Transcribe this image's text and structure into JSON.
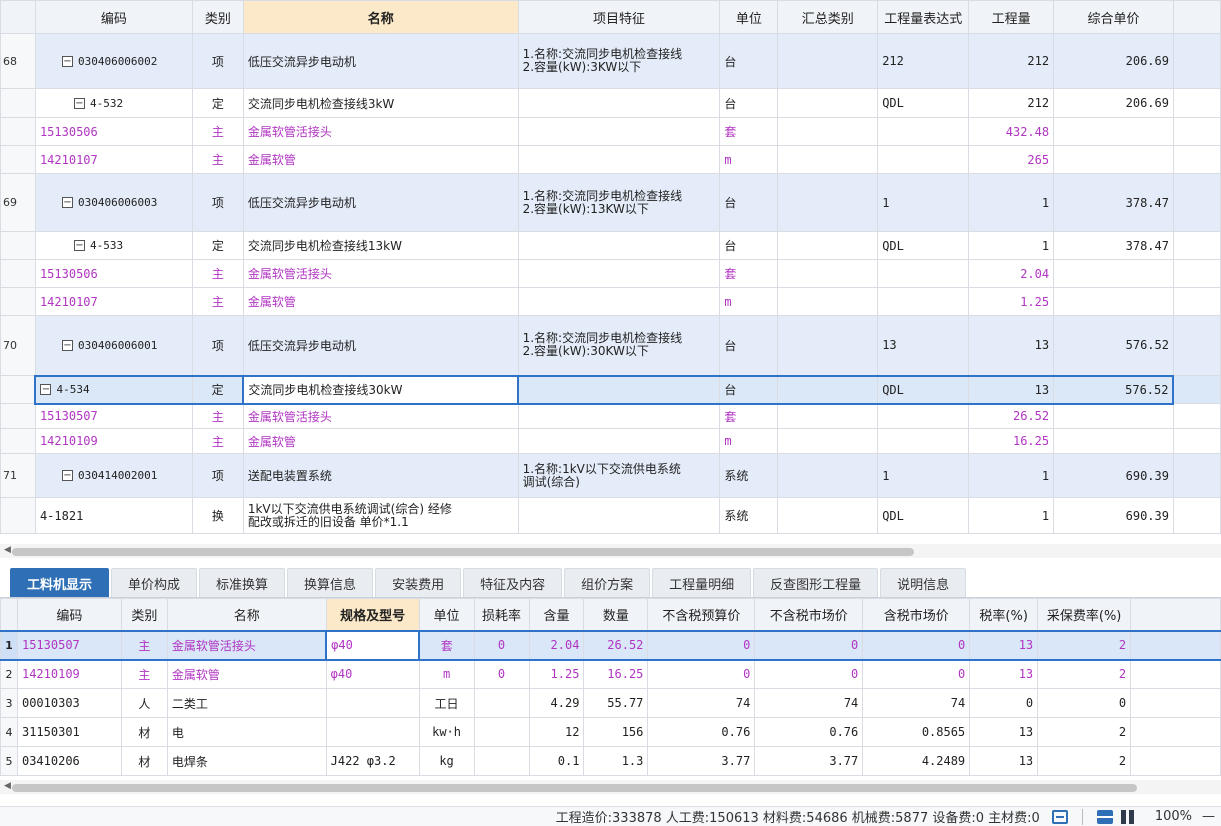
{
  "upper": {
    "headers": [
      "编码",
      "类别",
      "名称",
      "项目特征",
      "单位",
      "汇总类别",
      "工程量表达式",
      "工程量",
      "综合单价"
    ],
    "rows": [
      {
        "type": "item",
        "rn": "68",
        "code": "030406006002",
        "cat": "项",
        "name": "低压交流异步电动机",
        "feat1": "1.名称:交流同步电机检查接线",
        "feat2": "2.容量(kW):3KW以下",
        "unit": "台",
        "summary": "",
        "expr": "212",
        "qty": "212",
        "price": "206.69"
      },
      {
        "type": "quota",
        "rn": "",
        "code": "4-532",
        "cat": "定",
        "name": "交流同步电机检查接线3kW",
        "feat1": "",
        "feat2": "",
        "unit": "台",
        "summary": "",
        "expr": "QDL",
        "qty": "212",
        "price": "206.69"
      },
      {
        "type": "main",
        "rn": "",
        "code": "15130506",
        "cat": "主",
        "name": "金属软管活接头",
        "feat1": "",
        "feat2": "",
        "unit": "套",
        "summary": "",
        "expr": "",
        "qty": "432.48",
        "price": ""
      },
      {
        "type": "main",
        "rn": "",
        "code": "14210107",
        "cat": "主",
        "name": "金属软管",
        "feat1": "",
        "feat2": "",
        "unit": "m",
        "summary": "",
        "expr": "",
        "qty": "265",
        "price": ""
      },
      {
        "type": "item",
        "rn": "69",
        "code": "030406006003",
        "cat": "项",
        "name": "低压交流异步电动机",
        "feat1": "1.名称:交流同步电机检查接线",
        "feat2": "2.容量(kW):13KW以下",
        "unit": "台",
        "summary": "",
        "expr": "1",
        "qty": "1",
        "price": "378.47"
      },
      {
        "type": "quota",
        "rn": "",
        "code": "4-533",
        "cat": "定",
        "name": "交流同步电机检查接线13kW",
        "feat1": "",
        "feat2": "",
        "unit": "台",
        "summary": "",
        "expr": "QDL",
        "qty": "1",
        "price": "378.47"
      },
      {
        "type": "main",
        "rn": "",
        "code": "15130506",
        "cat": "主",
        "name": "金属软管活接头",
        "feat1": "",
        "feat2": "",
        "unit": "套",
        "summary": "",
        "expr": "",
        "qty": "2.04",
        "price": ""
      },
      {
        "type": "main",
        "rn": "",
        "code": "14210107",
        "cat": "主",
        "name": "金属软管",
        "feat1": "",
        "feat2": "",
        "unit": "m",
        "summary": "",
        "expr": "",
        "qty": "1.25",
        "price": ""
      },
      {
        "type": "item",
        "rn": "70",
        "code": "030406006001",
        "cat": "项",
        "name": "低压交流异步电动机",
        "feat1": "1.名称:交流同步电机检查接线",
        "feat2": "2.容量(kW):30KW以下",
        "unit": "台",
        "summary": "",
        "expr": "13",
        "qty": "13",
        "price": "576.52"
      },
      {
        "type": "quota-sel",
        "rn": "",
        "code": "4-534",
        "cat": "定",
        "name": "交流同步电机检查接线30kW",
        "feat1": "",
        "feat2": "",
        "unit": "台",
        "summary": "",
        "expr": "QDL",
        "qty": "13",
        "price": "576.52"
      },
      {
        "type": "main",
        "rn": "",
        "code": "15130507",
        "cat": "主",
        "name": "金属软管活接头",
        "feat1": "",
        "feat2": "",
        "unit": "套",
        "summary": "",
        "expr": "",
        "qty": "26.52",
        "price": ""
      },
      {
        "type": "main",
        "rn": "",
        "code": "14210109",
        "cat": "主",
        "name": "金属软管",
        "feat1": "",
        "feat2": "",
        "unit": "m",
        "summary": "",
        "expr": "",
        "qty": "16.25",
        "price": ""
      },
      {
        "type": "item",
        "rn": "71",
        "code": "030414002001",
        "cat": "项",
        "name": "送配电装置系统",
        "feat1": "1.名称:1kV以下交流供电系统",
        "feat2": "调试(综合)",
        "unit": "系统",
        "summary": "",
        "expr": "1",
        "qty": "1",
        "price": "690.39"
      },
      {
        "type": "swap",
        "rn": "",
        "code": "4-1821",
        "cat": "换",
        "name": "1kV以下交流供电系统调试(综合)  经修",
        "name2": "配改或拆迁的旧设备 单价*1.1",
        "feat1": "",
        "feat2": "",
        "unit": "系统",
        "summary": "",
        "expr": "QDL",
        "qty": "1",
        "price": "690.39"
      }
    ]
  },
  "tabs": [
    "工料机显示",
    "单价构成",
    "标准换算",
    "换算信息",
    "安装费用",
    "特征及内容",
    "组价方案",
    "工程量明细",
    "反查图形工程量",
    "说明信息"
  ],
  "lower": {
    "headers": [
      "编码",
      "类别",
      "名称",
      "规格及型号",
      "单位",
      "损耗率",
      "含量",
      "数量",
      "不含税预算价",
      "不含税市场价",
      "含税市场价",
      "税率(%)",
      "采保费率(%)"
    ],
    "rows": [
      {
        "rn": "1",
        "code": "15130507",
        "cat": "主",
        "name": "金属软管活接头",
        "spec": "φ40",
        "unit": "套",
        "loss": "0",
        "content": "2.04",
        "qty": "26.52",
        "budget": "0",
        "market": "0",
        "taxmarket": "0",
        "tax": "13",
        "fee": "2"
      },
      {
        "rn": "2",
        "code": "14210109",
        "cat": "主",
        "name": "金属软管",
        "spec": "φ40",
        "unit": "m",
        "loss": "0",
        "content": "1.25",
        "qty": "16.25",
        "budget": "0",
        "market": "0",
        "taxmarket": "0",
        "tax": "13",
        "fee": "2"
      },
      {
        "rn": "3",
        "code": "00010303",
        "cat": "人",
        "name": "二类工",
        "spec": "",
        "unit": "工日",
        "loss": "",
        "content": "4.29",
        "qty": "55.77",
        "budget": "74",
        "market": "74",
        "taxmarket": "74",
        "tax": "0",
        "fee": "0"
      },
      {
        "rn": "4",
        "code": "31150301",
        "cat": "材",
        "name": "电",
        "spec": "",
        "unit": "kw·h",
        "loss": "",
        "content": "12",
        "qty": "156",
        "budget": "0.76",
        "market": "0.76",
        "taxmarket": "0.8565",
        "tax": "13",
        "fee": "2"
      },
      {
        "rn": "5",
        "code": "03410206",
        "cat": "材",
        "name": "电焊条",
        "spec": "J422 φ3.2",
        "unit": "kg",
        "loss": "",
        "content": "0.1",
        "qty": "1.3",
        "budget": "3.77",
        "market": "3.77",
        "taxmarket": "4.2489",
        "tax": "13",
        "fee": "2"
      }
    ]
  },
  "status": {
    "summary": "工程造价:333878  人工费:150613  材料费:54686  机械费:5877  设备费:0  主材费:0",
    "zoom": "100%",
    "minus": "—"
  }
}
